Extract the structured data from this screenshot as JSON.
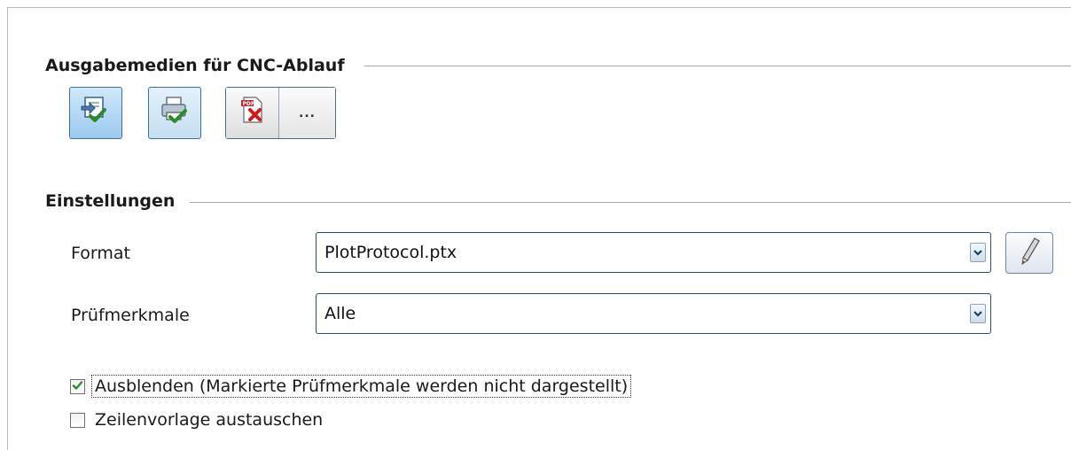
{
  "output_media": {
    "title": "Ausgabemedien für CNC-Ablauf",
    "buttons": [
      {
        "icon": "export-check-icon",
        "checked": true
      },
      {
        "icon": "printer-check-icon",
        "checked": false
      },
      {
        "icon": "pdf-remove-icon",
        "checked": false
      }
    ],
    "more_label": "..."
  },
  "settings": {
    "title": "Einstellungen",
    "format": {
      "label": "Format",
      "value": "PlotProtocol.ptx"
    },
    "features": {
      "label": "Prüfmerkmale",
      "value": "Alle"
    },
    "edit_icon": "pencil-icon"
  },
  "checkboxes": [
    {
      "label": "Ausblenden (Markierte Prüfmerkmale werden nicht dargestellt)",
      "checked": true
    },
    {
      "label": "Zeilenvorlage austauschen",
      "checked": false
    }
  ],
  "colors": {
    "accent": "#2a4f7a",
    "check": "#2b8a2b"
  }
}
